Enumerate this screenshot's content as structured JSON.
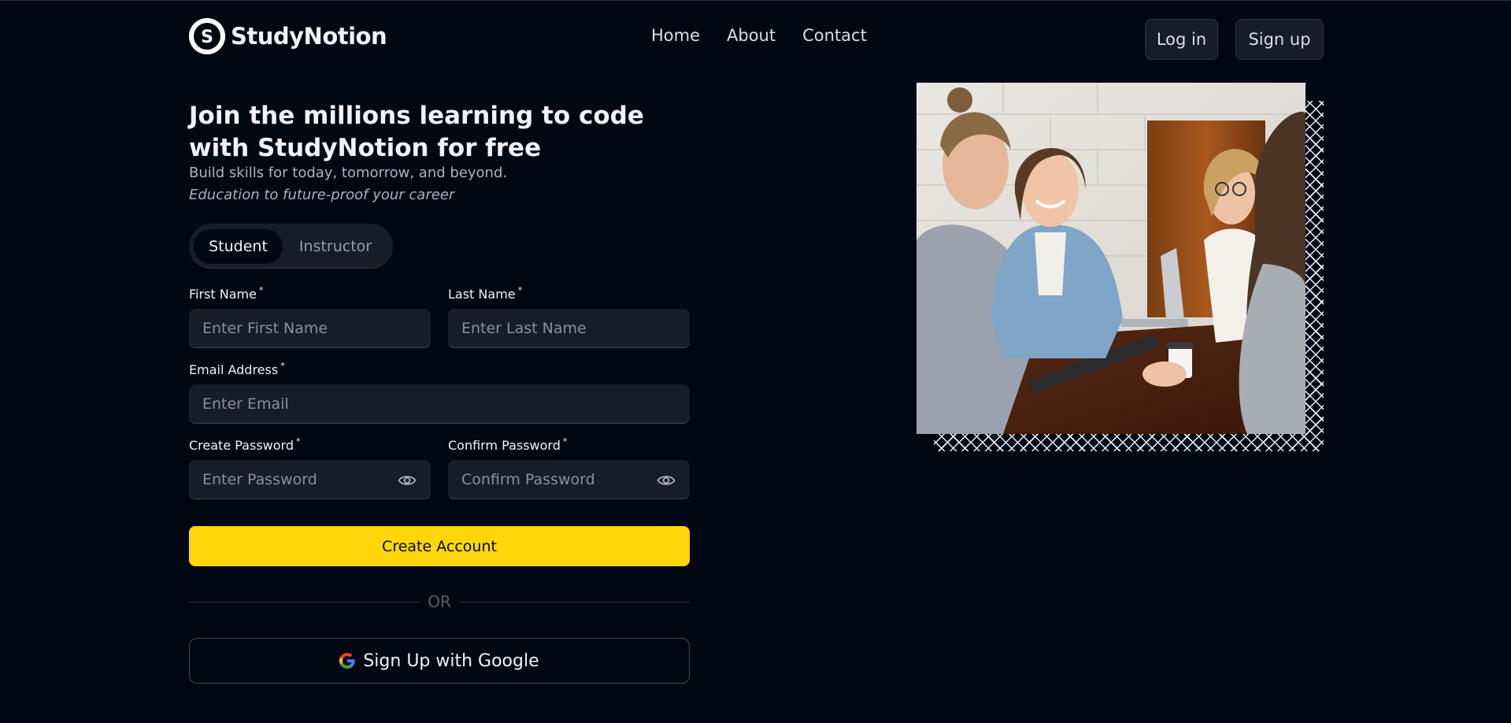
{
  "brand": {
    "name": "StudyNotion",
    "logo_letter": "S"
  },
  "nav": {
    "links": [
      "Home",
      "About",
      "Contact"
    ],
    "login_label": "Log in",
    "signup_label": "Sign up"
  },
  "hero": {
    "heading": "Join the millions learning to code with StudyNotion for free",
    "subtitle": "Build skills for today, tomorrow, and beyond.",
    "subtitle_italic": "Education to future-proof your career"
  },
  "account_type": {
    "options": [
      "Student",
      "Instructor"
    ],
    "selected": "Student"
  },
  "form": {
    "first_name": {
      "label": "First Name",
      "placeholder": "Enter First Name",
      "value": ""
    },
    "last_name": {
      "label": "Last Name",
      "placeholder": "Enter Last Name",
      "value": ""
    },
    "email": {
      "label": "Email Address",
      "placeholder": "Enter Email",
      "value": ""
    },
    "password": {
      "label": "Create Password",
      "placeholder": "Enter Password",
      "value": ""
    },
    "confirm_password": {
      "label": "Confirm Password",
      "placeholder": "Confirm Password",
      "value": ""
    },
    "required_marker": "*",
    "submit_label": "Create Account",
    "divider_text": "OR",
    "google_label": "Sign Up with Google"
  },
  "colors": {
    "background": "#000814",
    "surface": "#161d29",
    "accent": "#ffd60a",
    "text": "#f1f2ff",
    "muted": "#999daa"
  },
  "icons": {
    "password_toggle": "eye-icon",
    "google": "google-icon",
    "logo": "logo-icon"
  }
}
